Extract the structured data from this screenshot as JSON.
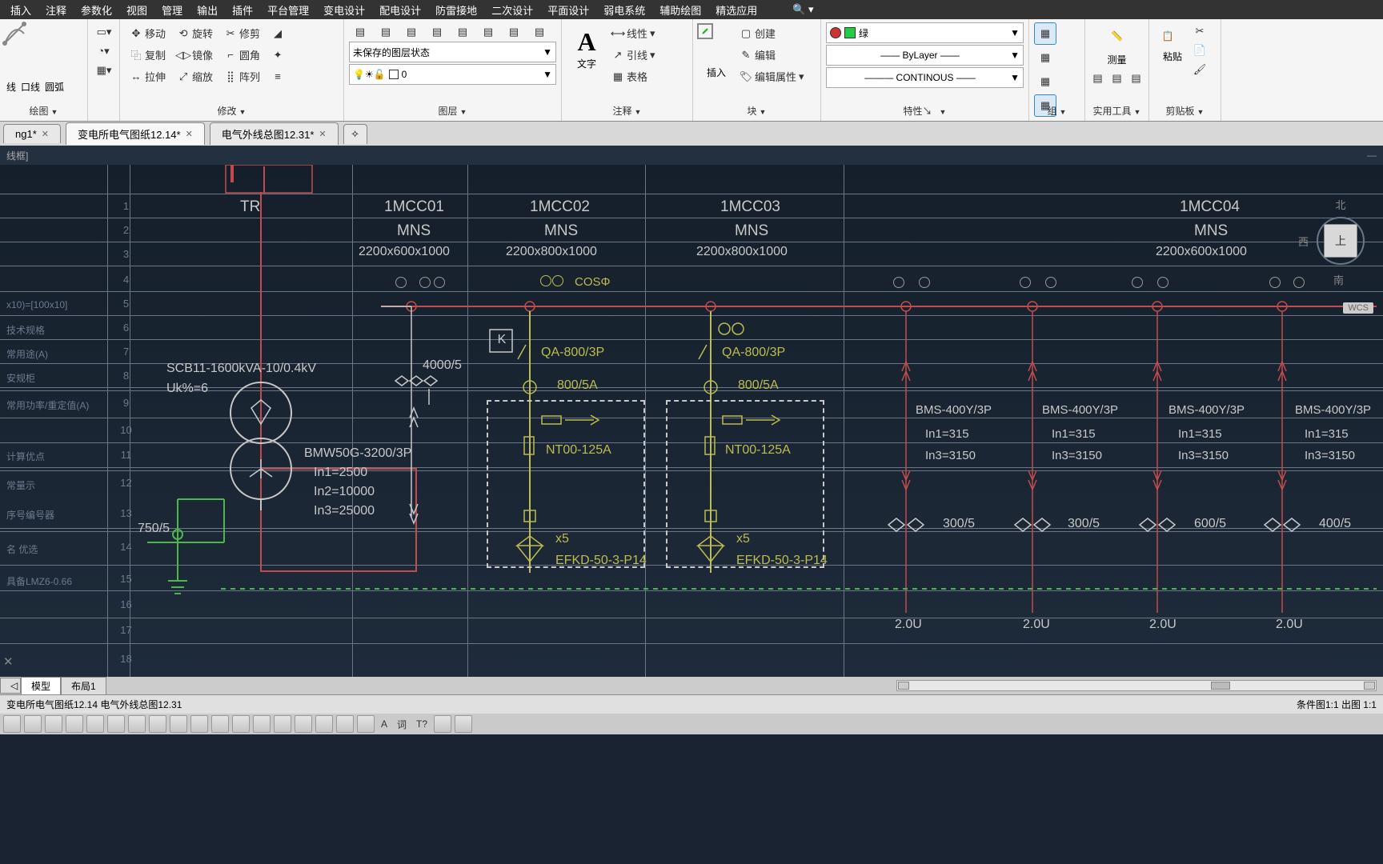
{
  "menubar": [
    "插入",
    "注释",
    "参数化",
    "视图",
    "管理",
    "输出",
    "插件",
    "平台管理",
    "变电设计",
    "配电设计",
    "防雷接地",
    "二次设计",
    "平面设计",
    "弱电系统",
    "辅助绘图",
    "精选应用"
  ],
  "ribbon": {
    "draw": {
      "title": "绘图"
    },
    "modify": {
      "title": "修改",
      "move": "移动",
      "rotate": "旋转",
      "trim": "修剪",
      "copy": "复制",
      "mirror": "镜像",
      "fillet": "圆角",
      "stretch": "拉伸",
      "scale": "缩放",
      "array": "阵列"
    },
    "layers": {
      "title": "图层",
      "unsaved": "未保存的图层状态",
      "current": "0"
    },
    "annot": {
      "title": "注释",
      "text": "文字",
      "line": "线性",
      "leader": "引线",
      "table": "表格"
    },
    "block": {
      "title": "块",
      "insert": "插入",
      "create": "创建",
      "edit": "编辑",
      "attr": "编辑属性"
    },
    "props": {
      "title": "特性",
      "color": "绿",
      "bylayer": "ByLayer",
      "ltype": "CONTINOUS"
    },
    "group": {
      "title": "组"
    },
    "util": {
      "title": "实用工具",
      "meas": "测量"
    },
    "clip": {
      "title": "剪贴板",
      "paste": "粘贴"
    }
  },
  "tabs": {
    "t1": "ng1*",
    "t2": "变电所电气图纸12.14*",
    "t3": "电气外线总图12.31*"
  },
  "dwg_title": "线框]",
  "layout_tabs": {
    "model": "模型",
    "layout1": "布局1"
  },
  "status_left": " 变电所电气图纸12.14    电气外线总图12.31",
  "status_right": "条件图1:1    出图 1:1",
  "viewcube": {
    "top": "上",
    "n": "北",
    "w": "西",
    "s": "南"
  },
  "row_nums": [
    "1",
    "2",
    "3",
    "4",
    "5",
    "6",
    "7",
    "8",
    "9",
    "10",
    "11",
    "12",
    "13",
    "14",
    "15",
    "16",
    "17",
    "18"
  ],
  "row_labels": {
    "r5": "x10)=[100x10]",
    "r6": "技术规格",
    "r7": "常用途(A)",
    "r8": "安规柜",
    "r9": "常用功率/重定值(A)",
    "r11": "计算优点",
    "r12": "常量示",
    "r13": "序号编号器",
    "r14": "名  优选",
    "r15": "  具备LMZ6-0.66"
  },
  "headers": {
    "TR": "TR",
    "c1": "1MCC01",
    "c2": "1MCC02",
    "c3": "1MCC03",
    "c4": "1MCC04"
  },
  "mns": "MNS",
  "dims": {
    "d1": "2200x600x1000",
    "d2": "2200x800x1000",
    "d3": "2200x800x1000",
    "d4": "2200x600x1000"
  },
  "cosp": "COSΦ",
  "transformer": {
    "name": "SCB11-1600kVA-10/0.4kV",
    "uk": "Uk%=6"
  },
  "breaker": {
    "name": "BMW50G-3200/3P",
    "in1": "In1=2500",
    "in2": "In2=10000",
    "in3": "In3=25000"
  },
  "ct_left": "4000/5",
  "ct_ground": "750/5",
  "box_k": "K",
  "qa": "QA-800/3P",
  "ct800": "800/5A",
  "nt": "NT00-125A",
  "cap": {
    "x5": "x5",
    "efkd": "EFKD-50-3-P14"
  },
  "bms": {
    "label": "BMS-400Y/3P",
    "in1": "In1=315",
    "in3": "In3=3150"
  },
  "ct_out": {
    "a": "300/5",
    "b": "300/5",
    "c": "600/5",
    "d": "400/5"
  },
  "feed": "2.0U",
  "wcs": "WCS"
}
